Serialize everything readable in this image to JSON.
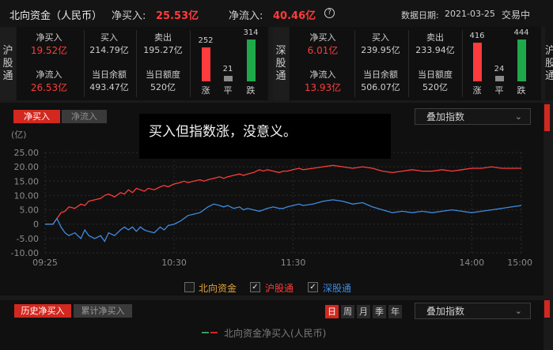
{
  "header": {
    "title": "北向资金（人民币）",
    "net_buy_label": "净买入:",
    "net_buy_value": "25.53亿",
    "net_inflow_label": "净流入:",
    "net_inflow_value": "40.46亿",
    "help_icon": "?",
    "date_label": "数据日期:",
    "date_value": "2021-03-25",
    "status": "交易中"
  },
  "sh": {
    "label": [
      "沪",
      "股",
      "通"
    ],
    "net_buy_label": "净买入",
    "net_buy": "19.52亿",
    "buy_label": "买入",
    "buy": "214.79亿",
    "sell_label": "卖出",
    "sell": "195.27亿",
    "net_inflow_label": "净流入",
    "net_inflow": "26.53亿",
    "balance_label": "当日余额",
    "balance": "493.47亿",
    "quota_label": "当日额度",
    "quota": "520亿",
    "up_count": "252",
    "flat_count": "21",
    "down_count": "314",
    "up_label": "涨",
    "flat_label": "平",
    "down_label": "跌"
  },
  "sz": {
    "label": [
      "深",
      "股",
      "通"
    ],
    "net_buy_label": "净买入",
    "net_buy": "6.01亿",
    "buy_label": "买入",
    "buy": "239.95亿",
    "sell_label": "卖出",
    "sell": "233.94亿",
    "net_inflow_label": "净流入",
    "net_inflow": "13.93亿",
    "balance_label": "当日余额",
    "balance": "506.07亿",
    "quota_label": "当日额度",
    "quota": "520亿",
    "up_count": "416",
    "flat_count": "24",
    "down_count": "444",
    "up_label": "涨",
    "flat_label": "平",
    "down_label": "跌"
  },
  "side_panel": {
    "label": [
      "沪",
      "股",
      "通"
    ]
  },
  "chart_tabs": {
    "net_buy": "净买入",
    "net_inflow": "净流入"
  },
  "overlay_dropdown": "叠加指数",
  "overlay_note": "买入但指数涨，没意义。",
  "chevron": "⌄",
  "colors": {
    "red": "#ff3b3b",
    "blue": "#3f8be0",
    "green": "#1fa84a",
    "accent": "#d2281f"
  },
  "chart_data": {
    "type": "line",
    "unit_label": "(亿)",
    "ylim": [
      -10,
      25
    ],
    "yticks": [
      -10,
      -5,
      0,
      5,
      10,
      15,
      20,
      25
    ],
    "ytick_labels": [
      "-10.00",
      "-5.00",
      "0",
      "5.00",
      "10.00",
      "15.00",
      "20.00",
      "25.00"
    ],
    "x_ticks": [
      "09:25",
      "10:30",
      "11:30",
      "14:00",
      "15:00"
    ],
    "x_ticks_pos": [
      0,
      65,
      125,
      215,
      240
    ],
    "grid": true,
    "series": [
      {
        "name": "沪股通",
        "color": "#ff3b3b",
        "x": [
          0,
          4,
          6,
          8,
          10,
          12,
          15,
          18,
          20,
          22,
          25,
          28,
          30,
          32,
          35,
          38,
          40,
          42,
          44,
          46,
          48,
          50,
          52,
          55,
          58,
          60,
          62,
          65,
          68,
          70,
          72,
          75,
          78,
          80,
          82,
          85,
          88,
          90,
          92,
          95,
          98,
          100,
          102,
          105,
          108,
          110,
          112,
          115,
          118,
          120,
          122,
          125,
          128,
          130,
          135,
          140,
          145,
          150,
          155,
          160,
          165,
          170,
          175,
          180,
          185,
          190,
          195,
          200,
          205,
          210,
          215,
          220,
          225,
          230,
          235,
          240
        ],
        "values": [
          0,
          0,
          2,
          4,
          4.5,
          6,
          5.5,
          7,
          6.5,
          8,
          8.5,
          9,
          10,
          10.5,
          9.5,
          11,
          10.5,
          12,
          11,
          12.5,
          12,
          11.5,
          12.5,
          12,
          13,
          13.5,
          13,
          14,
          14.5,
          15,
          14.5,
          15,
          15.5,
          15,
          15.5,
          16,
          16.5,
          16,
          16.5,
          17,
          17.5,
          17,
          17.5,
          18,
          19,
          18.5,
          19,
          18.5,
          18,
          18.5,
          18.5,
          19,
          19.5,
          19,
          19.5,
          20,
          20.5,
          20,
          19.5,
          20,
          19.5,
          18.5,
          18,
          18.5,
          19,
          18.5,
          18.5,
          19,
          18.5,
          19,
          19.5,
          19.5,
          20,
          19.5,
          19.5,
          19.5
        ]
      },
      {
        "name": "深股通",
        "color": "#3f8be0",
        "x": [
          0,
          4,
          6,
          8,
          10,
          12,
          15,
          18,
          20,
          22,
          25,
          28,
          30,
          32,
          35,
          38,
          40,
          42,
          44,
          46,
          48,
          50,
          52,
          55,
          58,
          60,
          62,
          65,
          68,
          70,
          72,
          75,
          78,
          80,
          82,
          85,
          88,
          90,
          92,
          95,
          98,
          100,
          102,
          105,
          108,
          110,
          112,
          115,
          118,
          120,
          122,
          125,
          128,
          130,
          135,
          140,
          145,
          150,
          155,
          160,
          165,
          170,
          175,
          180,
          185,
          190,
          195,
          200,
          205,
          210,
          215,
          220,
          225,
          230,
          235,
          240
        ],
        "values": [
          0,
          0,
          2,
          -1,
          -3,
          -4,
          -3,
          -5,
          -2,
          -4,
          -5,
          -4,
          -6,
          -3,
          -4,
          -2,
          -1,
          -2,
          -1,
          -2.5,
          -1,
          -2,
          -2.5,
          -3,
          -1,
          -2,
          -0.5,
          0,
          1,
          2,
          3,
          3.5,
          4,
          5,
          6,
          7,
          6.5,
          6,
          6.5,
          5.5,
          6,
          5,
          5.5,
          5,
          4.5,
          5,
          5.5,
          6,
          5.5,
          5.5,
          6,
          6.5,
          7,
          6.5,
          7,
          8,
          8.5,
          8,
          7,
          7.5,
          6,
          5,
          4,
          4.5,
          4,
          4.5,
          4,
          4.5,
          5,
          4.5,
          4,
          4.5,
          5,
          5.5,
          6,
          6.5
        ]
      }
    ]
  },
  "legend": {
    "north": "北向资金",
    "sh": "沪股通",
    "sz": "深股通",
    "check": "✓"
  },
  "bottom": {
    "tab_hist": "历史净买入",
    "tab_cum": "累计净买入",
    "periods": [
      "日",
      "周",
      "月",
      "季",
      "年"
    ],
    "dropdown": "叠加指数",
    "legend_label": "北向资金净买入(人民币)"
  }
}
